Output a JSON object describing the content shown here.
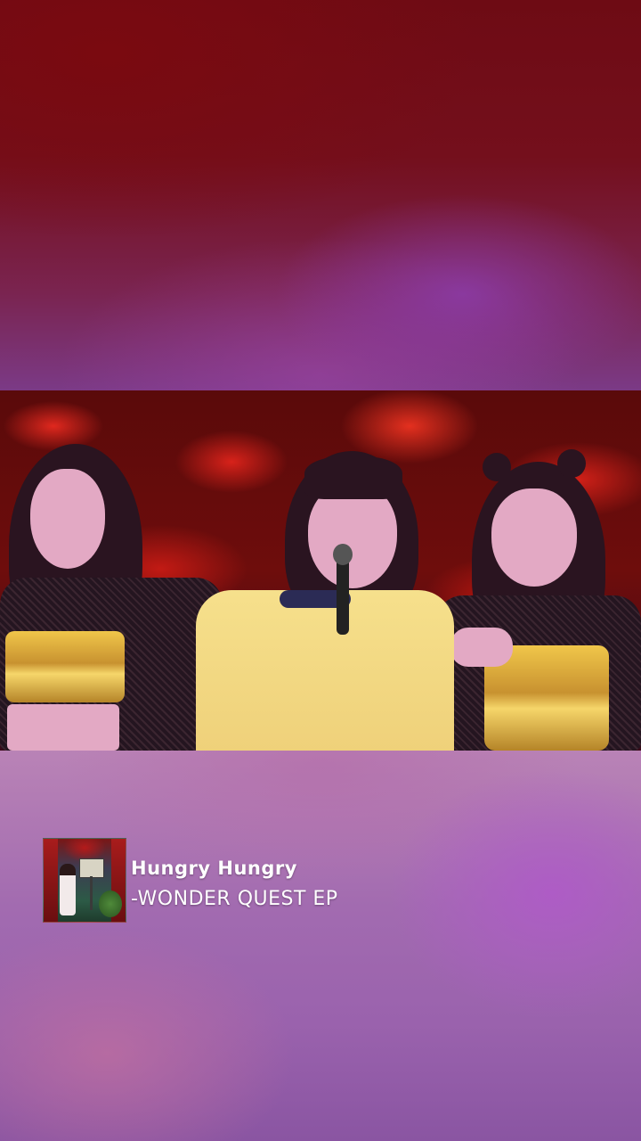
{
  "media": {
    "song_title": "Hungry Hungry",
    "album_title": "-WONDER QUEST EP",
    "album_art_icon": "album-cover-image"
  },
  "colors": {
    "top_background": "#6e0b14",
    "bottom_background": "#a26bb0",
    "text": "#ffffff"
  }
}
